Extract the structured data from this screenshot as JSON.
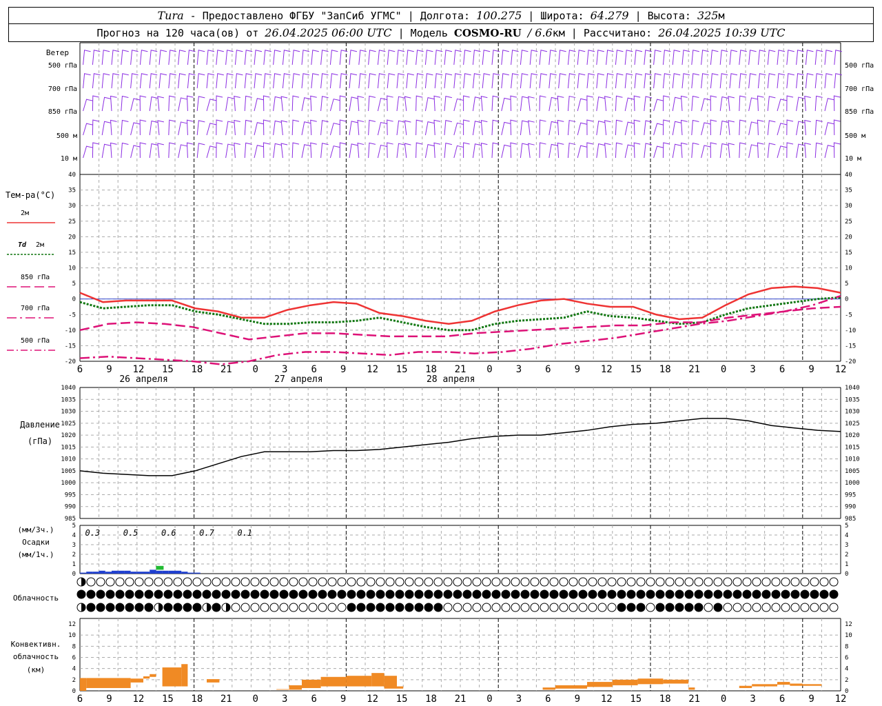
{
  "header": {
    "station": "Tura",
    "provider": "- Предоставлено ФГБУ \"ЗапСиб УГМС\" |",
    "lon_label": "Долгота:",
    "lon": "100.275",
    "lat_label": "| Широта:",
    "lat": "64.279",
    "alt_label": "| Высота:",
    "alt": "325",
    "alt_unit": "м",
    "forecast_label": "Прогноз на 120 часа(ов) от",
    "forecast_start": "26.04.2025 06:00 UTC",
    "model_label": "| Модель",
    "model": "COSMO-RU",
    "resolution": "/ 6.6",
    "resolution_unit": "км",
    "calc_label": "| Рассчитано:",
    "calc_time": "26.04.2025 10:39 UTC"
  },
  "time_axis": {
    "hour_ticks": [
      "6",
      "9",
      "12",
      "15",
      "18",
      "21",
      "0",
      "3",
      "6",
      "9",
      "12",
      "15",
      "18",
      "21",
      "0",
      "3",
      "6",
      "9",
      "12",
      "15",
      "18",
      "21",
      "0",
      "3",
      "6",
      "9",
      "12"
    ],
    "date_labels": [
      "26 апреля",
      "27 апреля",
      "28 апреля"
    ]
  },
  "wind_panel": {
    "title": "Ветер",
    "levels": [
      "500 гПа",
      "700 гПа",
      "850 гПа",
      "500 м",
      "10 м"
    ],
    "levels_right": [
      "500 гПа",
      "700 гПа",
      "850 гПа",
      "500 м",
      "10 м"
    ],
    "color": "#8a2be2"
  },
  "temp_panel": {
    "title": "Тем-ра(°C)",
    "legend": [
      {
        "name": "2м",
        "style": "solid",
        "color": "#ee3333"
      },
      {
        "name": "Td",
        "suffix": "2м",
        "style": "dotted",
        "color": "#117711"
      },
      {
        "name": "850 гПа",
        "style": "dashed",
        "color": "#dd1177"
      },
      {
        "name": "700 гПа",
        "style": "dashdot",
        "color": "#dd1177"
      },
      {
        "name": "500 гПа",
        "style": "dashdot2",
        "color": "#dd1177"
      }
    ],
    "y_ticks": [
      "40",
      "35",
      "30",
      "25",
      "20",
      "15",
      "10",
      "5",
      "0",
      "-5",
      "-10",
      "-15",
      "-20"
    ]
  },
  "pressure_panel": {
    "title": "Давление",
    "unit": "(гПа)",
    "y_ticks": [
      "1040",
      "1035",
      "1030",
      "1025",
      "1020",
      "1015",
      "1010",
      "1005",
      "1000",
      "995",
      "990",
      "985"
    ]
  },
  "precip_panel": {
    "unit3": "(мм/3ч.)",
    "title": "Осадки",
    "unit1": "(мм/1ч.)",
    "y_ticks": [
      "5",
      "4",
      "3",
      "2",
      "1",
      "0"
    ],
    "totals": [
      "0.3",
      "0.5",
      "0.6",
      "0.7",
      "0.1"
    ]
  },
  "cloud_panel": {
    "title": "Облачность"
  },
  "conv_panel": {
    "title1": "Конвективн.",
    "title2": "облачность",
    "unit": "(км)",
    "y_ticks": [
      "12",
      "10",
      "8",
      "6",
      "4",
      "2",
      "0"
    ]
  },
  "chart_data": [
    {
      "type": "line",
      "title": "Тем-ра(°C)",
      "x_hours": [
        0,
        3,
        6,
        9,
        12,
        15,
        18,
        21,
        24,
        27,
        30,
        33,
        36,
        39,
        42,
        45,
        48,
        51,
        54,
        57,
        60,
        63,
        66,
        69,
        72,
        75,
        78
      ],
      "ylim": [
        -20,
        40
      ],
      "series": [
        {
          "name": "2м",
          "values": [
            2,
            -1,
            -0.5,
            -0.5,
            -0.5,
            -3,
            -4,
            -6,
            -6,
            -3.5,
            -2,
            -1,
            -1.5,
            -4.5,
            -5.5,
            -7,
            -8,
            -7,
            -4,
            -2,
            -0.5,
            0,
            -1.5,
            -2.5,
            -2.5,
            -5,
            -6.5,
            -6,
            -2,
            1.5,
            3.5,
            4,
            3.5,
            2
          ]
        },
        {
          "name": "Td 2м",
          "values": [
            -1,
            -3,
            -2.5,
            -2,
            -2,
            -4,
            -5,
            -6.5,
            -8,
            -8,
            -7.5,
            -7.5,
            -7,
            -6,
            -7.5,
            -9,
            -10,
            -10,
            -8,
            -7,
            -6.5,
            -6,
            -4,
            -5.5,
            -6,
            -7,
            -8,
            -7.5,
            -5,
            -3,
            -2,
            -1,
            0,
            0.5
          ]
        },
        {
          "name": "850 гПа",
          "values": [
            -10,
            -8,
            -7.5,
            -8,
            -9,
            -11,
            -13,
            -12,
            -11,
            -11,
            -11.5,
            -12,
            -12,
            -12,
            -11,
            -10.5,
            -10,
            -9.5,
            -9,
            -8.5,
            -8.5,
            -7.5,
            -7.5,
            -6,
            -5,
            -4,
            -3,
            -2.5
          ]
        },
        {
          "name": "700 гПа",
          "values": [
            -19,
            -18.5,
            -19,
            -19.5,
            -20,
            -21,
            -20,
            -18,
            -17,
            -17,
            -17.5,
            -18,
            -17,
            -17,
            -17.5,
            -17,
            -16,
            -14.5,
            -13.5,
            -12.5,
            -11,
            -9.5,
            -8,
            -7,
            -5.5,
            -4,
            -2,
            1
          ]
        },
        {
          "name": "500 гПа",
          "values": []
        }
      ]
    },
    {
      "type": "line",
      "title": "Давление",
      "ylabel": "(гПа)",
      "ylim": [
        985,
        1040
      ],
      "x_hours": [
        0,
        3,
        6,
        9,
        12,
        15,
        18,
        21,
        24,
        27,
        30,
        33,
        36,
        39,
        42,
        45,
        48,
        51,
        54,
        57,
        60,
        63,
        66,
        69,
        72,
        75,
        78,
        81,
        84,
        87,
        90
      ],
      "values": [
        1005,
        1004,
        1003.5,
        1003,
        1003,
        1005,
        1008,
        1011,
        1013,
        1013,
        1013,
        1013.5,
        1013.5,
        1014,
        1015,
        1016,
        1017,
        1018.5,
        1019.5,
        1020,
        1020,
        1021,
        1022,
        1023.5,
        1024.5,
        1025,
        1026,
        1027,
        1027,
        1026,
        1024,
        1023,
        1022,
        1021.5
      ]
    },
    {
      "type": "bar",
      "title": "Осадки",
      "ylim": [
        0,
        5
      ],
      "hourly_mm": [
        0.1,
        0.2,
        0.2,
        0.3,
        0.2,
        0.3,
        0.3,
        0.3,
        0.2,
        0.2,
        0.2,
        0.4,
        0.3,
        0.3,
        0.3,
        0.3,
        0.2,
        0.1,
        0.1
      ],
      "three_hour_mm": [
        0.5
      ],
      "totals_6h": [
        0.3,
        0.5,
        0.6,
        0.7,
        0.1
      ]
    },
    {
      "type": "area",
      "title": "Конвективн. облачность (км)",
      "ylim": [
        0,
        13
      ],
      "segments": [
        {
          "start_h": 0,
          "end_h": 1,
          "top_km": 2.3,
          "base_km": 0
        },
        {
          "start_h": 1,
          "end_h": 8,
          "top_km": 2.3,
          "base_km": 0.5
        },
        {
          "start_h": 8,
          "end_h": 10,
          "top_km": 2.2,
          "base_km": 1.5
        },
        {
          "start_h": 10,
          "end_h": 11,
          "top_km": 2.6,
          "base_km": 2.2
        },
        {
          "start_h": 11,
          "end_h": 12,
          "top_km": 3,
          "base_km": 2.5
        },
        {
          "start_h": 13,
          "end_h": 16,
          "top_km": 4.2,
          "base_km": 0.8
        },
        {
          "start_h": 16,
          "end_h": 17,
          "top_km": 4.8,
          "base_km": 0.8
        },
        {
          "start_h": 20,
          "end_h": 22,
          "top_km": 2.1,
          "base_km": 1.5
        },
        {
          "start_h": 31,
          "end_h": 33,
          "top_km": 0.3,
          "base_km": 0.2
        },
        {
          "start_h": 33,
          "end_h": 35,
          "top_km": 1,
          "base_km": 0.2
        },
        {
          "start_h": 35,
          "end_h": 38,
          "top_km": 2,
          "base_km": 0.5
        },
        {
          "start_h": 38,
          "end_h": 42,
          "top_km": 2.5,
          "base_km": 0.8
        },
        {
          "start_h": 42,
          "end_h": 46,
          "top_km": 2.7,
          "base_km": 0.8
        },
        {
          "start_h": 46,
          "end_h": 48,
          "top_km": 3.2,
          "base_km": 0.8
        },
        {
          "start_h": 48,
          "end_h": 50,
          "top_km": 2.7,
          "base_km": 0.4
        },
        {
          "start_h": 50,
          "end_h": 51,
          "top_km": 0.8,
          "base_km": 0.4
        },
        {
          "start_h": 73,
          "end_h": 75,
          "top_km": 0.6,
          "base_km": 0.2
        },
        {
          "start_h": 75,
          "end_h": 80,
          "top_km": 1,
          "base_km": 0.4
        },
        {
          "start_h": 80,
          "end_h": 84,
          "top_km": 1.6,
          "base_km": 0.7
        },
        {
          "start_h": 84,
          "end_h": 88,
          "top_km": 2.0,
          "base_km": 1.0
        },
        {
          "start_h": 88,
          "end_h": 92,
          "top_km": 2.2,
          "base_km": 1.2
        },
        {
          "start_h": 92,
          "end_h": 96,
          "top_km": 2.0,
          "base_km": 1.3
        },
        {
          "start_h": 96,
          "end_h": 97,
          "top_km": 0.6,
          "base_km": 0.2
        },
        {
          "start_h": 104,
          "end_h": 106,
          "top_km": 0.9,
          "base_km": 0.5
        },
        {
          "start_h": 106,
          "end_h": 110,
          "top_km": 1.2,
          "base_km": 0.8
        },
        {
          "start_h": 110,
          "end_h": 112,
          "top_km": 1.6,
          "base_km": 1.1
        },
        {
          "start_h": 112,
          "end_h": 114,
          "top_km": 1.3,
          "base_km": 0.9
        },
        {
          "start_h": 114,
          "end_h": 117,
          "top_km": 1.2,
          "base_km": 0.9
        }
      ]
    },
    {
      "type": "table",
      "title": "Облачность",
      "levels": [
        "upper",
        "middle",
        "lower"
      ],
      "cover_octas": {
        "upper": [
          2,
          0,
          0,
          0,
          0,
          0,
          0,
          0,
          0,
          0,
          0,
          0,
          0,
          0,
          0,
          0,
          0,
          0,
          0,
          0,
          0,
          0,
          0,
          0,
          0,
          0,
          0,
          0,
          0,
          0,
          0,
          0,
          0,
          0,
          0,
          0,
          0,
          0,
          0,
          0,
          0,
          0,
          0,
          0,
          0,
          0,
          0,
          0,
          0,
          0,
          0,
          0,
          0,
          0,
          0,
          0,
          0,
          0,
          0,
          0,
          0,
          0,
          0,
          0,
          0,
          0,
          0,
          0,
          0,
          0,
          0,
          0,
          0,
          0,
          0,
          0,
          0,
          0,
          0,
          0,
          0,
          0,
          0,
          0,
          0,
          0,
          0,
          0,
          0,
          0,
          0,
          0,
          0,
          0,
          0,
          0,
          0,
          0,
          0,
          0,
          0,
          0,
          0,
          0,
          0,
          0,
          0,
          0,
          0,
          0,
          0,
          0,
          0,
          0,
          0,
          0,
          0,
          0,
          0
        ],
        "middle": [
          8,
          8,
          8,
          8,
          8,
          8,
          8,
          8,
          8,
          8,
          8,
          8,
          8,
          8,
          8,
          8,
          8,
          8,
          8,
          8,
          8,
          8,
          8,
          8,
          8,
          8,
          8,
          8,
          8,
          8,
          8,
          8,
          8,
          8,
          8,
          8,
          8,
          8,
          8,
          8,
          8,
          8,
          8,
          8,
          8,
          8,
          8,
          8,
          8,
          8,
          8,
          8,
          8,
          8,
          8,
          8,
          8,
          8,
          8,
          8,
          8,
          8,
          8,
          8,
          8,
          8,
          8,
          8,
          8,
          8,
          8,
          8,
          8,
          8,
          8,
          8,
          8,
          8,
          8,
          8,
          8,
          8,
          8,
          8,
          8,
          8,
          8,
          8,
          8,
          8,
          8,
          8,
          8,
          8,
          8,
          8,
          8,
          8,
          8,
          8,
          8,
          8,
          8,
          8,
          8,
          8,
          8,
          8,
          8,
          8,
          8,
          8,
          8,
          8,
          8,
          8,
          8,
          8,
          8
        ],
        "lower": [
          4,
          8,
          8,
          8,
          8,
          8,
          8,
          8,
          4,
          8,
          8,
          8,
          8,
          4,
          8,
          4,
          0,
          0,
          0,
          0,
          0,
          0,
          0,
          0,
          0,
          0,
          0,
          0,
          8,
          8,
          8,
          8,
          8,
          8,
          8,
          8,
          8,
          8,
          0,
          0,
          0,
          0,
          0,
          0,
          0,
          0,
          0,
          0,
          0,
          0,
          0,
          0,
          0,
          0,
          0,
          0,
          8,
          8,
          8,
          0,
          8,
          8,
          8,
          8,
          8,
          0,
          8,
          0,
          0,
          0,
          0,
          0,
          0,
          0,
          0,
          0,
          0,
          0,
          0,
          0,
          0,
          0,
          0,
          0,
          0,
          0,
          0,
          0,
          0,
          0,
          0,
          0,
          0,
          0,
          0,
          0,
          0,
          0,
          0,
          0,
          0,
          0,
          0,
          0,
          8,
          0,
          0,
          0,
          0,
          0,
          0,
          0,
          0,
          0,
          0,
          0,
          0,
          0,
          0,
          0,
          0,
          0,
          0,
          0,
          0,
          0,
          0
        ]
      }
    }
  ]
}
